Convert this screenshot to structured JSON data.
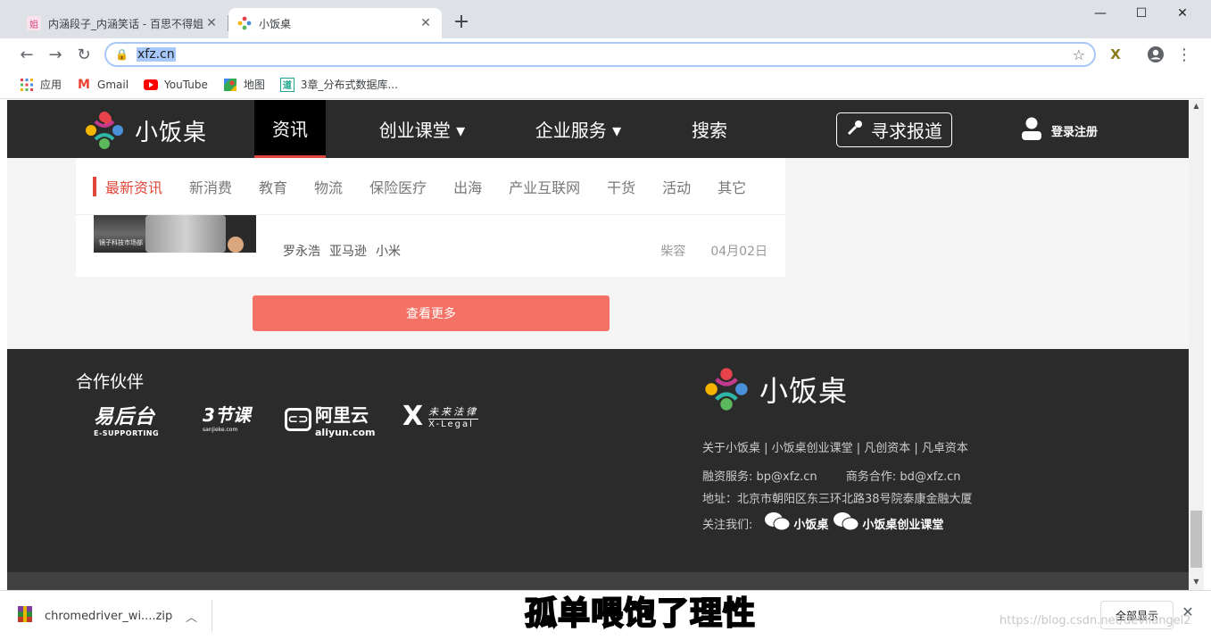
{
  "browser": {
    "tabs": [
      {
        "title": "内涵段子_内涵笑话 - 百思不得姐",
        "favicon": "姐"
      },
      {
        "title": "小饭桌",
        "favicon": "xfz-logo-icon"
      }
    ],
    "new_tab": "+",
    "window_controls": {
      "minimize": "—",
      "maximize": "☐",
      "close": "✕"
    },
    "url": "xfz.cn",
    "bookmarks": [
      {
        "label": "应用",
        "icon": "apps-grid-icon"
      },
      {
        "label": "Gmail",
        "icon": "gmail-icon"
      },
      {
        "label": "YouTube",
        "icon": "youtube-icon"
      },
      {
        "label": "地图",
        "icon": "maps-icon"
      },
      {
        "label": "3章_分布式数据库...",
        "icon": "doc-icon"
      }
    ]
  },
  "site": {
    "logo_text": "小饭桌",
    "nav": [
      {
        "label": "资讯",
        "active": true
      },
      {
        "label": "创业课堂 ▾",
        "active": false
      },
      {
        "label": "企业服务 ▾",
        "active": false
      },
      {
        "label": "搜索",
        "active": false
      }
    ],
    "report_button": "寻求报道",
    "login": "登录注册",
    "subnav": [
      "最新资讯",
      "新消费",
      "教育",
      "物流",
      "保险医疗",
      "出海",
      "产业互联网",
      "干货",
      "活动",
      "其它"
    ],
    "article": {
      "image_caption": "镜子科技市场部",
      "tags": [
        "罗永浩",
        "亚马逊",
        "小米"
      ],
      "author": "柴容",
      "date": "04月02日"
    },
    "more_button": "查看更多",
    "footer": {
      "partners_title": "合作伙伴",
      "partners": [
        {
          "name": "易后台",
          "sub": "E-SUPPORTING"
        },
        {
          "name": "3节课",
          "sub": "sanjieke.com"
        },
        {
          "name": "阿里云",
          "sub": "aliyun.com"
        },
        {
          "name": "未来法律",
          "sub": "X-Legal"
        }
      ],
      "logo_text": "小饭桌",
      "links": "关于小饭桌 | 小饭桌创业课堂 | 凡创资本 | 凡卓资本",
      "finance": "融资服务:  bp@xfz.cn",
      "business": "商务合作:  bd@xfz.cn",
      "address": "地址：北京市朝阳区东三环北路38号院泰康金融大厦",
      "follow_label": "关注我们:",
      "follow": [
        "小饭桌",
        "小饭桌创业课堂"
      ]
    }
  },
  "download": {
    "file": "chromedriver_wi....zip",
    "show_all": "全部显示",
    "close": "✕"
  },
  "overlay": {
    "subtitle": "孤单喂饱了理性",
    "watermark": "https://blog.csdn.net/devilangel2"
  }
}
